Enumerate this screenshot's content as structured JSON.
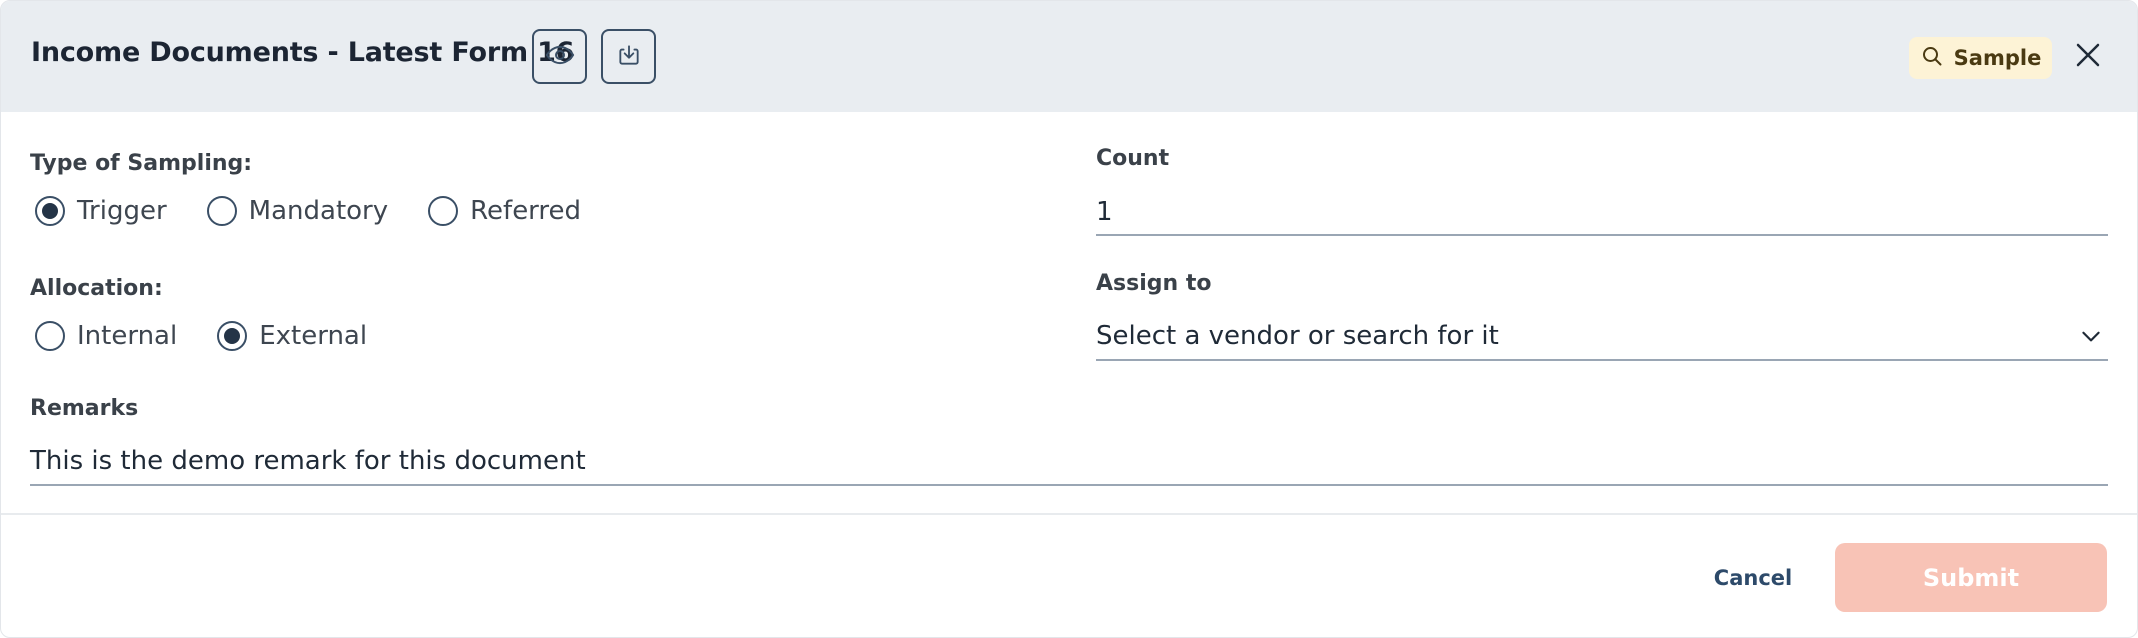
{
  "header": {
    "title": "Income Documents - Latest Form 16",
    "view_icon": "eye-icon",
    "download_icon": "download-icon",
    "badge_label": "Sample",
    "badge_icon": "search-icon",
    "close_icon": "close-icon"
  },
  "sampling": {
    "label": "Type of Sampling:",
    "options": [
      "Trigger",
      "Mandatory",
      "Referred"
    ],
    "selected": "Trigger"
  },
  "allocation": {
    "label": "Allocation:",
    "options": [
      "Internal",
      "External"
    ],
    "selected": "External"
  },
  "count": {
    "label": "Count",
    "value": "1"
  },
  "assign_to": {
    "label": "Assign to",
    "placeholder": "Select a vendor or search for it",
    "chevron_icon": "chevron-down-icon"
  },
  "remarks": {
    "label": "Remarks",
    "value": "This is the demo remark for this document"
  },
  "footer": {
    "cancel_label": "Cancel",
    "submit_label": "Submit"
  },
  "colors": {
    "header_bg": "#e9edf1",
    "badge_bg": "#fdf3d6",
    "submit_disabled": "#f8c3b6",
    "accent": "#243447"
  }
}
